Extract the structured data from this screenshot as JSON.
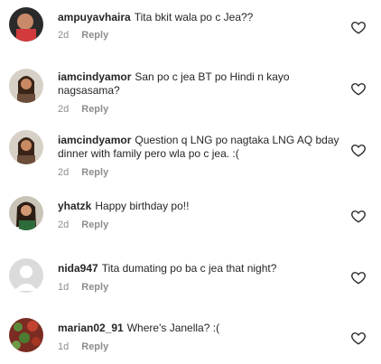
{
  "reply_label": "Reply",
  "comments": [
    {
      "username": "ampuyavhaira",
      "text": "Tita bkit wala po c Jea??",
      "time": "2d"
    },
    {
      "username": "iamcindyamor",
      "text": "San po c jea BT po Hindi n kayo nagsasama?",
      "time": "2d"
    },
    {
      "username": "iamcindyamor",
      "text": "Question q LNG po nagtaka LNG AQ bday dinner with family pero wla po c jea. :(",
      "time": "2d"
    },
    {
      "username": "yhatzk",
      "text": "Happy birthday po!!",
      "time": "2d"
    },
    {
      "username": "nida947",
      "text": "Tita dumating po ba c jea that night?",
      "time": "1d"
    },
    {
      "username": "marian02_91",
      "text": "Where's Janella? :(",
      "time": "1d"
    }
  ],
  "icons": {
    "like": "heart-outline-icon",
    "avatar_default": "default-avatar-icon"
  }
}
